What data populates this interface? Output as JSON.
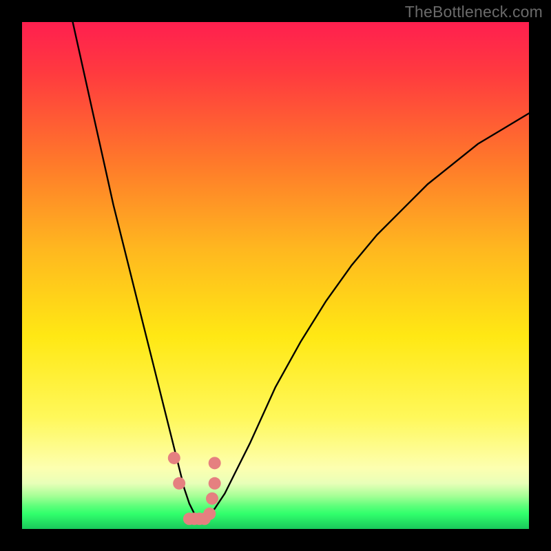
{
  "watermark": "TheBottleneck.com",
  "chart_data": {
    "type": "line",
    "title": "",
    "xlabel": "",
    "ylabel": "",
    "xlim": [
      0,
      100
    ],
    "ylim": [
      0,
      100
    ],
    "grid": false,
    "series": [
      {
        "name": "curve",
        "x": [
          10,
          12,
          14,
          16,
          18,
          20,
          22,
          24,
          26,
          28,
          30,
          31,
          32,
          33,
          34,
          35,
          36,
          37,
          38,
          40,
          42,
          45,
          50,
          55,
          60,
          65,
          70,
          75,
          80,
          85,
          90,
          95,
          100
        ],
        "values": [
          100,
          91,
          82,
          73,
          64,
          56,
          48,
          40,
          32,
          24,
          16,
          12,
          8,
          5,
          3,
          2,
          2,
          3,
          4,
          7,
          11,
          17,
          28,
          37,
          45,
          52,
          58,
          63,
          68,
          72,
          76,
          79,
          82
        ]
      }
    ],
    "markers": {
      "name": "dots",
      "color": "#e58080",
      "x": [
        30,
        31,
        33,
        34,
        35,
        36,
        37,
        37.5,
        38,
        38
      ],
      "values": [
        14,
        9,
        2,
        2,
        2,
        2,
        3,
        6,
        9,
        13
      ]
    },
    "background_gradient": {
      "top": "#ff1f4f",
      "mid": "#ffe814",
      "bottom": "#31ff6c"
    }
  }
}
